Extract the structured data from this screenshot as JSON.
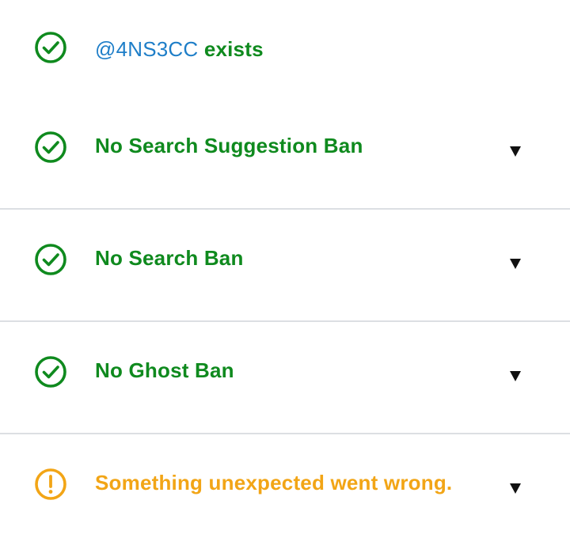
{
  "results": {
    "exists": {
      "handle": "@4NS3CC",
      "suffix": " exists",
      "icon": "check-circle-icon",
      "status": "ok"
    },
    "items": [
      {
        "label": "No Search Suggestion Ban",
        "icon": "check-circle-icon",
        "status": "ok",
        "toggle_icon": "triangle-down-icon"
      },
      {
        "label": "No Search Ban",
        "icon": "check-circle-icon",
        "status": "ok",
        "toggle_icon": "triangle-down-icon"
      },
      {
        "label": "No Ghost Ban",
        "icon": "check-circle-icon",
        "status": "ok",
        "toggle_icon": "triangle-down-icon"
      },
      {
        "label": "Something unexpected went wrong.",
        "icon": "exclamation-circle-icon",
        "status": "warning",
        "toggle_icon": "triangle-down-icon"
      }
    ]
  },
  "colors": {
    "ok": "#0f8a1e",
    "warning": "#f2a516",
    "handle": "#1e7ec8",
    "divider": "#dcdfe3"
  }
}
